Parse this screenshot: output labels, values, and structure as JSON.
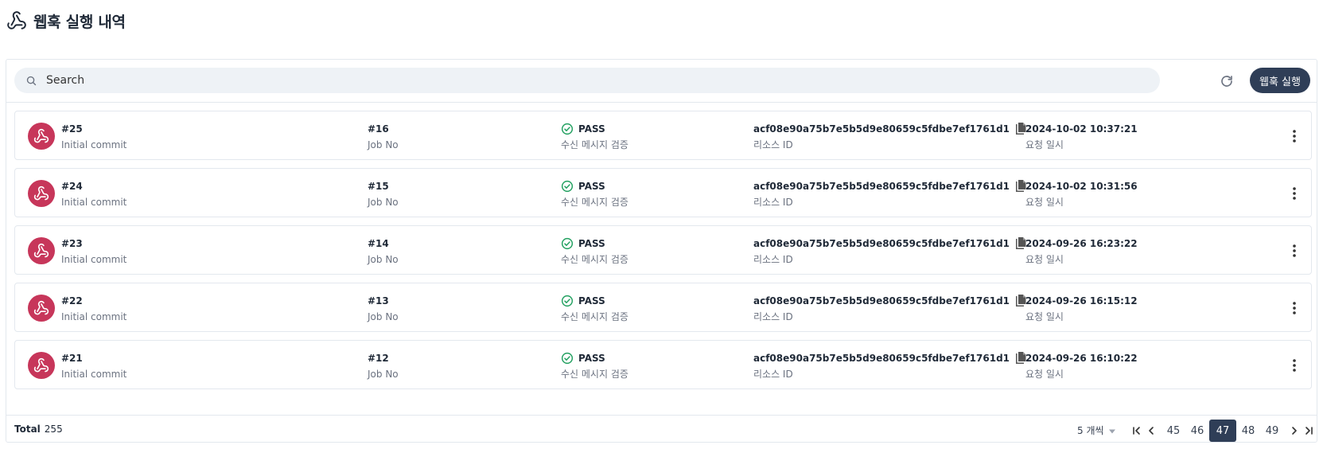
{
  "header": {
    "title": "웹훅 실행 내역"
  },
  "search": {
    "placeholder": "Search"
  },
  "toolbar": {
    "run_label": "웹훅 실행"
  },
  "rows": [
    {
      "title": "#25",
      "subtitle": "Initial commit",
      "job": "#16",
      "job_label": "Job No",
      "status": "PASS",
      "status_label": "수신 메시지 검증",
      "resource_id": "acf08e90a75b7e5b5d9e80659c5fdbe7ef1761d1",
      "resource_label": "리소스 ID",
      "date": "2024-10-02 10:37:21",
      "date_label": "요청 일시"
    },
    {
      "title": "#24",
      "subtitle": "Initial commit",
      "job": "#15",
      "job_label": "Job No",
      "status": "PASS",
      "status_label": "수신 메시지 검증",
      "resource_id": "acf08e90a75b7e5b5d9e80659c5fdbe7ef1761d1",
      "resource_label": "리소스 ID",
      "date": "2024-10-02 10:31:56",
      "date_label": "요청 일시"
    },
    {
      "title": "#23",
      "subtitle": "Initial commit",
      "job": "#14",
      "job_label": "Job No",
      "status": "PASS",
      "status_label": "수신 메시지 검증",
      "resource_id": "acf08e90a75b7e5b5d9e80659c5fdbe7ef1761d1",
      "resource_label": "리소스 ID",
      "date": "2024-09-26 16:23:22",
      "date_label": "요청 일시"
    },
    {
      "title": "#22",
      "subtitle": "Initial commit",
      "job": "#13",
      "job_label": "Job No",
      "status": "PASS",
      "status_label": "수신 메시지 검증",
      "resource_id": "acf08e90a75b7e5b5d9e80659c5fdbe7ef1761d1",
      "resource_label": "리소스 ID",
      "date": "2024-09-26 16:15:12",
      "date_label": "요청 일시"
    },
    {
      "title": "#21",
      "subtitle": "Initial commit",
      "job": "#12",
      "job_label": "Job No",
      "status": "PASS",
      "status_label": "수신 메시지 검증",
      "resource_id": "acf08e90a75b7e5b5d9e80659c5fdbe7ef1761d1",
      "resource_label": "리소스 ID",
      "date": "2024-09-26 16:10:22",
      "date_label": "요청 일시"
    }
  ],
  "footer": {
    "total_label": "Total",
    "total_value": "255",
    "page_size": "5 개씩",
    "pages": [
      "45",
      "46",
      "47",
      "48",
      "49"
    ],
    "current_page": "47"
  },
  "colors": {
    "accent": "#2f3e57",
    "avatar": "#c7365a",
    "pass": "#22a060"
  },
  "icons": {
    "header": "webhook-icon",
    "search": "search-icon",
    "refresh": "refresh-icon",
    "status": "check-circle-icon",
    "copy": "copy-icon",
    "more": "more-vertical-icon"
  }
}
